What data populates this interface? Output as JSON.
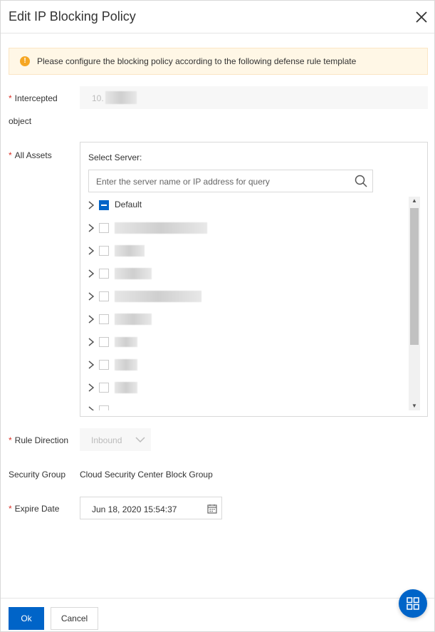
{
  "dialog": {
    "title": "Edit IP Blocking Policy",
    "close_icon": "close-icon"
  },
  "alert": {
    "icon": "warning-icon",
    "text": "Please configure the blocking policy according to the following defense rule template"
  },
  "form": {
    "intercepted_object": {
      "required": "*",
      "label_line1": "Intercepted",
      "label_line2": "object",
      "value": "10."
    },
    "all_assets": {
      "required": "*",
      "label": "All Assets",
      "select_server_label": "Select Server:",
      "search_placeholder": "Enter the server name or IP address for query",
      "search_icon": "search-icon",
      "tree": [
        {
          "label": "Default",
          "state": "partial"
        },
        {
          "label": "",
          "state": "unchecked"
        },
        {
          "label": "",
          "state": "unchecked"
        },
        {
          "label": "",
          "state": "unchecked"
        },
        {
          "label": "",
          "state": "unchecked"
        },
        {
          "label": "",
          "state": "unchecked"
        },
        {
          "label": "",
          "state": "unchecked"
        },
        {
          "label": "",
          "state": "unchecked"
        },
        {
          "label": "",
          "state": "unchecked"
        }
      ]
    },
    "rule_direction": {
      "required": "*",
      "label": "Rule Direction",
      "value": "Inbound"
    },
    "security_group": {
      "label": "Security Group",
      "value": "Cloud Security Center Block Group"
    },
    "expire_date": {
      "required": "*",
      "label": "Expire Date",
      "value": "Jun 18, 2020 15:54:37",
      "icon": "calendar-icon"
    }
  },
  "footer": {
    "ok_label": "Ok",
    "cancel_label": "Cancel"
  },
  "colors": {
    "primary": "#0064c8",
    "required": "#d93026",
    "alert_bg": "#fff7e6",
    "alert_icon": "#f5a623"
  },
  "fab_icon": "grid-icon"
}
